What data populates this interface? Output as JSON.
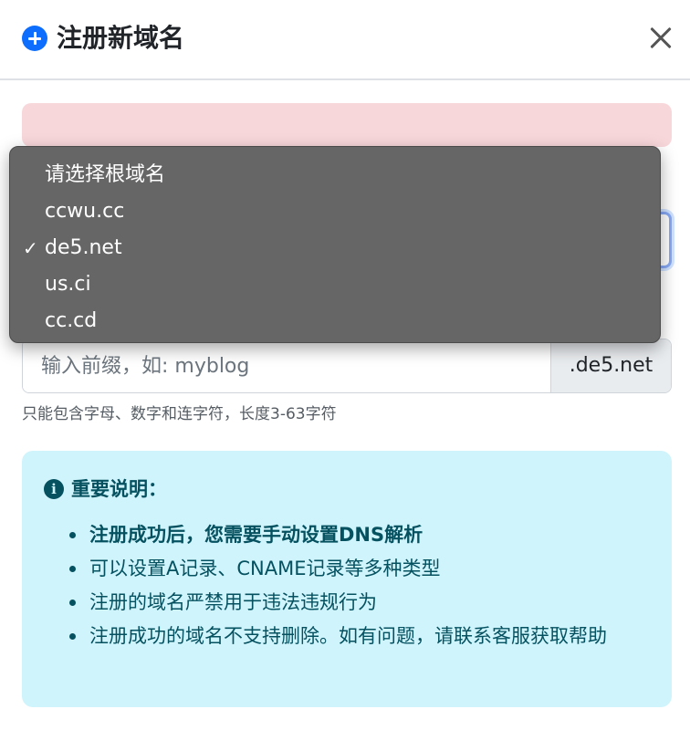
{
  "modal": {
    "title": "注册新域名",
    "close_label": "×"
  },
  "dropdown": {
    "options": [
      "请选择根域名",
      "ccwu.cc",
      "de5.net",
      "us.ci",
      "cc.cd"
    ],
    "selected": "de5.net",
    "check": "✓"
  },
  "prefix_input": {
    "placeholder": "输入前缀，如: myblog",
    "value": "",
    "suffix": ".de5.net"
  },
  "help_text": "只能包含字母、数字和连字符，长度3-63字符",
  "info": {
    "icon": "i",
    "title": "重要说明：",
    "items": [
      "注册成功后，您需要手动设置DNS解析",
      "可以设置A记录、CNAME记录等多种类型",
      "注册的域名严禁用于违法违规行为",
      "注册成功的域名不支持删除。如有问题，请联系客服获取帮助"
    ]
  },
  "colors": {
    "primary": "#0d6efd",
    "danger_bg": "#f8d7da",
    "info_bg": "#cff4fc",
    "info_text": "#055160",
    "dropdown_bg": "#666667"
  },
  "icons": [
    "plus-circle-icon",
    "close-icon",
    "info-circle-icon",
    "checkmark-icon"
  ]
}
